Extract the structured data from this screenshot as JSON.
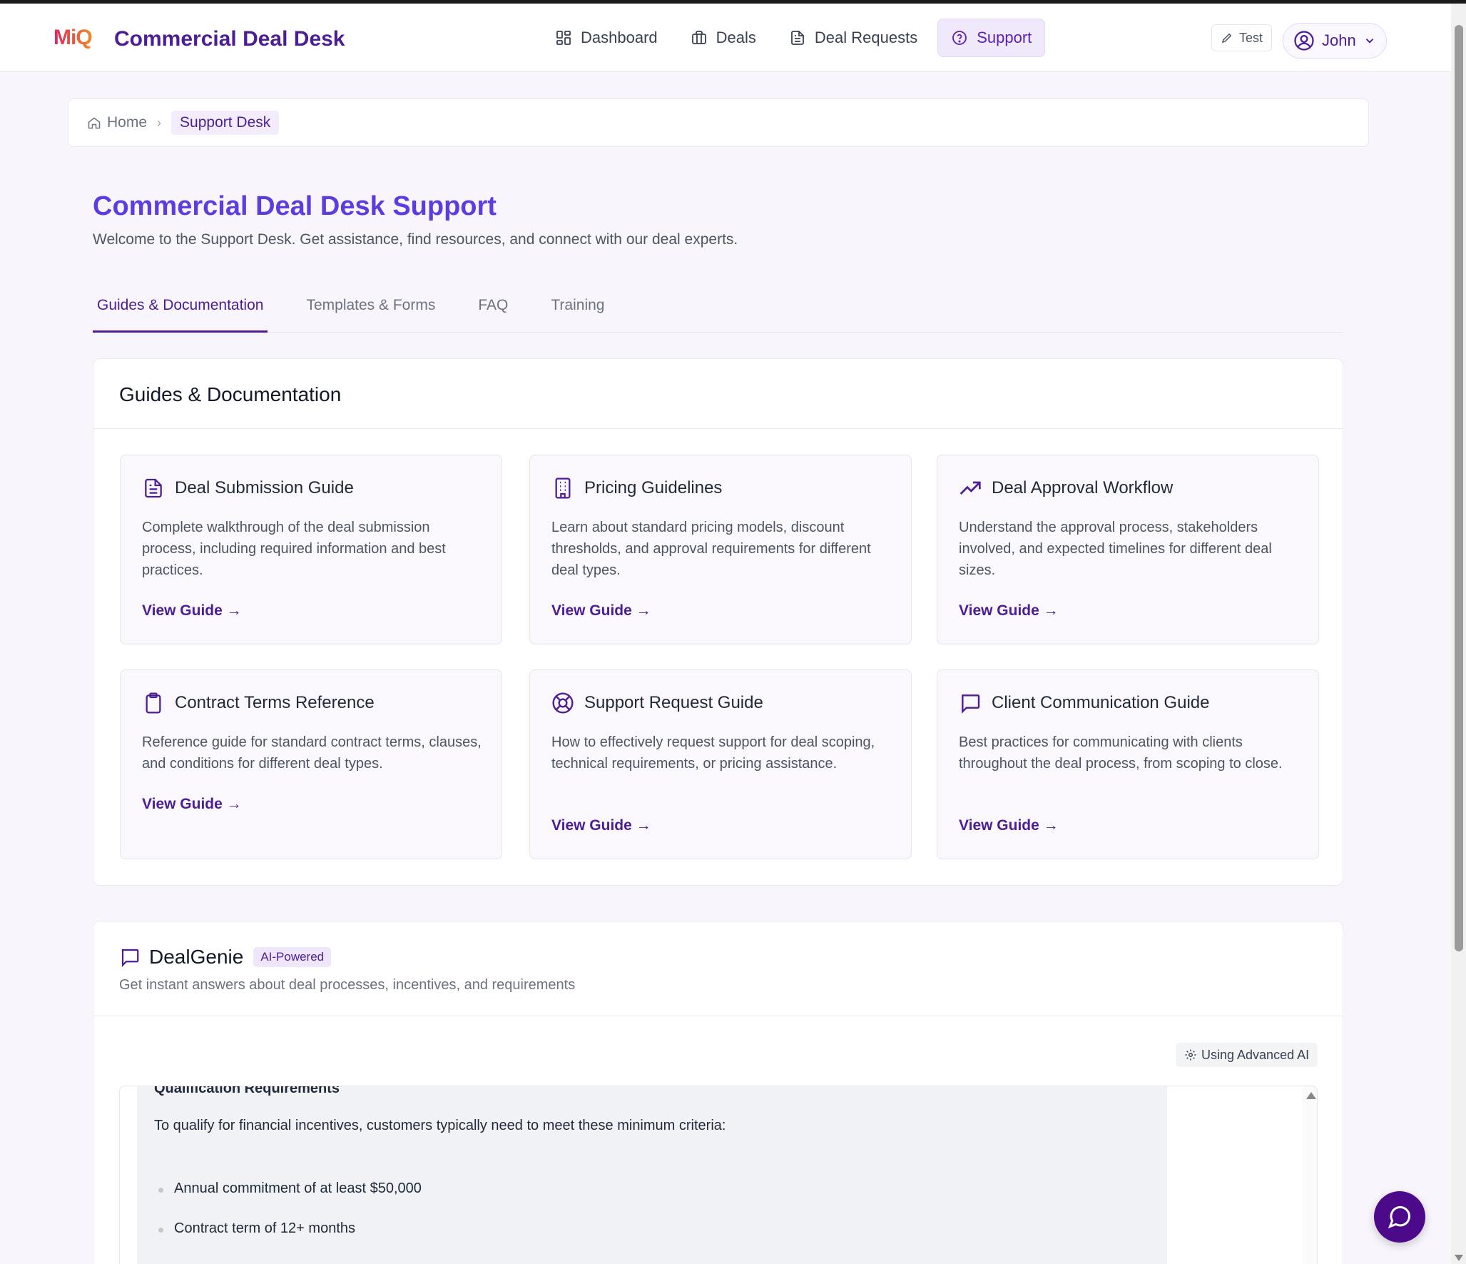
{
  "brand": {
    "logo": "MiQ",
    "app_title": "Commercial Deal Desk"
  },
  "nav": {
    "items": [
      {
        "label": "Dashboard",
        "icon": "dashboard-grid-icon",
        "active": false
      },
      {
        "label": "Deals",
        "icon": "briefcase-icon",
        "active": false
      },
      {
        "label": "Deal Requests",
        "icon": "document-icon",
        "active": false
      },
      {
        "label": "Support",
        "icon": "help-circle-icon",
        "active": true
      }
    ],
    "test_label": "Test",
    "user_name": "John"
  },
  "breadcrumb": {
    "home": "Home",
    "separator": "›",
    "current": "Support Desk"
  },
  "page": {
    "title": "Commercial Deal Desk Support",
    "subtitle": "Welcome to the Support Desk. Get assistance, find resources, and connect with our deal experts."
  },
  "tabs": [
    {
      "label": "Guides & Documentation",
      "active": true
    },
    {
      "label": "Templates & Forms",
      "active": false
    },
    {
      "label": "FAQ",
      "active": false
    },
    {
      "label": "Training",
      "active": false
    }
  ],
  "guides": {
    "title": "Guides & Documentation",
    "cards": [
      {
        "title": "Deal Submission Guide",
        "icon": "document-icon",
        "description": "Complete walkthrough of the deal submission process, including required information and best practices.",
        "link": "View Guide →"
      },
      {
        "title": "Pricing Guidelines",
        "icon": "building-icon",
        "description": "Learn about standard pricing models, discount thresholds, and approval requirements for different deal types.",
        "link": "View Guide →"
      },
      {
        "title": "Deal Approval Workflow",
        "icon": "trending-up-icon",
        "description": "Understand the approval process, stakeholders involved, and expected timelines for different deal sizes.",
        "link": "View Guide →"
      },
      {
        "title": "Contract Terms Reference",
        "icon": "clipboard-icon",
        "description": "Reference guide for standard contract terms, clauses, and conditions for different deal types.",
        "link": "View Guide →"
      },
      {
        "title": "Support Request Guide",
        "icon": "lifebuoy-icon",
        "description": "How to effectively request support for deal scoping, technical requirements, or pricing assistance.",
        "link": "View Guide →"
      },
      {
        "title": "Client Communication Guide",
        "icon": "chat-bubble-icon",
        "description": "Best practices for communicating with clients throughout the deal process, from scoping to close.",
        "link": "View Guide →"
      }
    ]
  },
  "dealgenie": {
    "title": "DealGenie",
    "badge": "AI-Powered",
    "subtitle": "Get instant answers about deal processes, incentives, and requirements",
    "ai_pill": "Using Advanced AI",
    "message": {
      "heading_cut": "Qualification Requirements",
      "intro": "To qualify for financial incentives, customers typically need to meet these minimum criteria:",
      "bullets": [
        "Annual commitment of at least $50,000",
        "Contract term of 12+ months"
      ]
    }
  },
  "colors": {
    "accent": "#4c1d95",
    "title": "#5b3ee0",
    "fab": "#4c0a8a"
  }
}
